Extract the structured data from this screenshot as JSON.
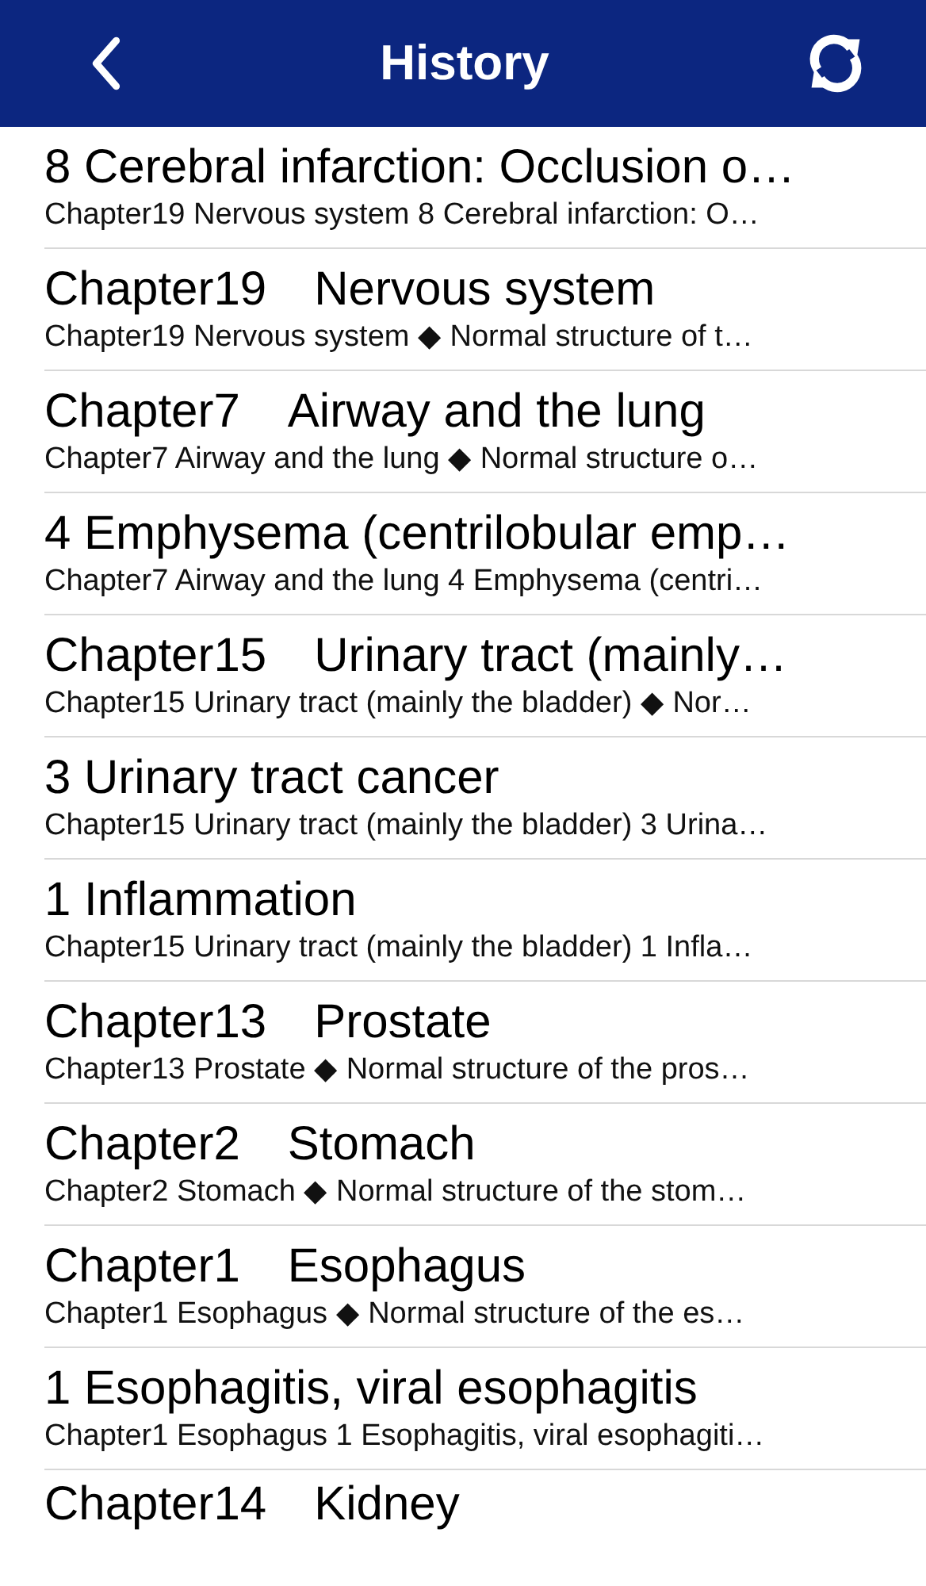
{
  "nav_bar": {
    "title": "History"
  },
  "items": [
    {
      "title": "8 Cerebral infarction: Occlusion o…",
      "subtitle": "Chapter19 Nervous system 8 Cerebral infarction: O…"
    },
    {
      "title": "Chapter19　Nervous system",
      "subtitle": "Chapter19 Nervous system ◆ Normal structure of t…"
    },
    {
      "title": "Chapter7　Airway and the lung",
      "subtitle": "Chapter7 Airway and the lung ◆ Normal structure o…"
    },
    {
      "title": "4 Emphysema (centrilobular emp…",
      "subtitle": "Chapter7 Airway and the lung 4 Emphysema (centri…"
    },
    {
      "title": "Chapter15　Urinary tract (mainly…",
      "subtitle": "Chapter15 Urinary tract (mainly the bladder) ◆ Nor…"
    },
    {
      "title": "3 Urinary tract cancer",
      "subtitle": "Chapter15 Urinary tract (mainly the bladder) 3 Urina…"
    },
    {
      "title": "1 Inflammation",
      "subtitle": "Chapter15 Urinary tract (mainly the bladder) 1 Infla…"
    },
    {
      "title": "Chapter13　Prostate",
      "subtitle": "Chapter13 Prostate ◆ Normal structure of the pros…"
    },
    {
      "title": "Chapter2　Stomach",
      "subtitle": "Chapter2 Stomach ◆ Normal structure of the stom…"
    },
    {
      "title": "Chapter1　Esophagus",
      "subtitle": "Chapter1 Esophagus ◆ Normal structure of the es…"
    },
    {
      "title": "1 Esophagitis, viral esophagitis",
      "subtitle": "Chapter1 Esophagus 1 Esophagitis, viral esophagiti…"
    },
    {
      "title": "Chapter14　Kidney"
    }
  ]
}
